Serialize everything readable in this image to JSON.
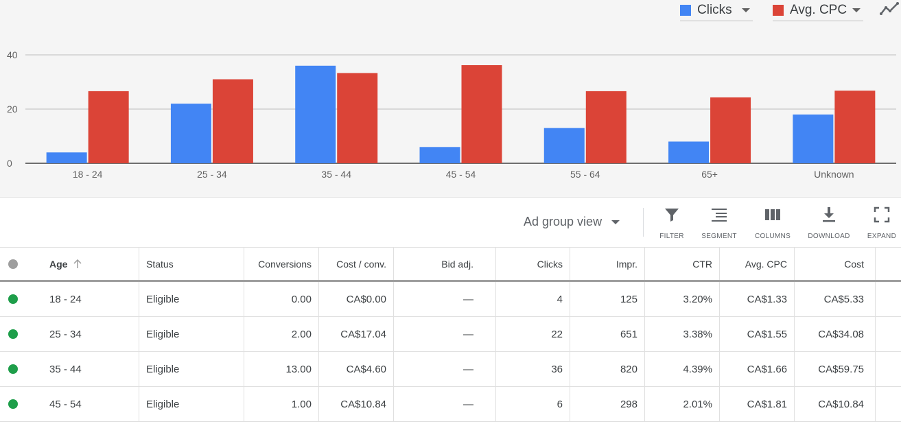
{
  "chart_controls": {
    "metric1": {
      "label": "Clicks",
      "color": "#4285f4"
    },
    "metric2": {
      "label": "Avg. CPC",
      "color": "#db4437"
    },
    "trend_icon": "trend-line-icon"
  },
  "chart_data": {
    "type": "bar",
    "categories": [
      "18 - 24",
      "25 - 34",
      "35 - 44",
      "45 - 54",
      "55 - 64",
      "65+",
      "Unknown"
    ],
    "series": [
      {
        "name": "Clicks",
        "color": "#4285f4",
        "values": [
          4,
          22,
          36,
          6,
          13,
          8,
          18
        ]
      },
      {
        "name": "Avg. CPC",
        "color": "#db4437",
        "values": [
          26.6,
          31,
          33.3,
          36.2,
          26.6,
          24.3,
          26.8
        ]
      }
    ],
    "y_ticks": [
      0,
      20,
      40
    ],
    "ylim": [
      0,
      40
    ],
    "grid": true
  },
  "toolbar": {
    "view_label": "Ad group view",
    "filter_label": "FILTER",
    "segment_label": "SEGMENT",
    "columns_label": "COLUMNS",
    "download_label": "DOWNLOAD",
    "expand_label": "EXPAND"
  },
  "table": {
    "headers": {
      "age": "Age",
      "status": "Status",
      "conversions": "Conversions",
      "cost_conv": "Cost / conv.",
      "bid_adj": "Bid adj.",
      "clicks": "Clicks",
      "impr": "Impr.",
      "ctr": "CTR",
      "avg_cpc": "Avg. CPC",
      "cost": "Cost"
    },
    "rows": [
      {
        "age": "18 - 24",
        "status": "Eligible",
        "conversions": "0.00",
        "cost_conv": "CA$0.00",
        "bid_adj": "—",
        "clicks": "4",
        "impr": "125",
        "ctr": "3.20%",
        "avg_cpc": "CA$1.33",
        "cost": "CA$5.33"
      },
      {
        "age": "25 - 34",
        "status": "Eligible",
        "conversions": "2.00",
        "cost_conv": "CA$17.04",
        "bid_adj": "—",
        "clicks": "22",
        "impr": "651",
        "ctr": "3.38%",
        "avg_cpc": "CA$1.55",
        "cost": "CA$34.08"
      },
      {
        "age": "35 - 44",
        "status": "Eligible",
        "conversions": "13.00",
        "cost_conv": "CA$4.60",
        "bid_adj": "—",
        "clicks": "36",
        "impr": "820",
        "ctr": "4.39%",
        "avg_cpc": "CA$1.66",
        "cost": "CA$59.75"
      },
      {
        "age": "45 - 54",
        "status": "Eligible",
        "conversions": "1.00",
        "cost_conv": "CA$10.84",
        "bid_adj": "—",
        "clicks": "6",
        "impr": "298",
        "ctr": "2.01%",
        "avg_cpc": "CA$1.81",
        "cost": "CA$10.84"
      }
    ]
  }
}
